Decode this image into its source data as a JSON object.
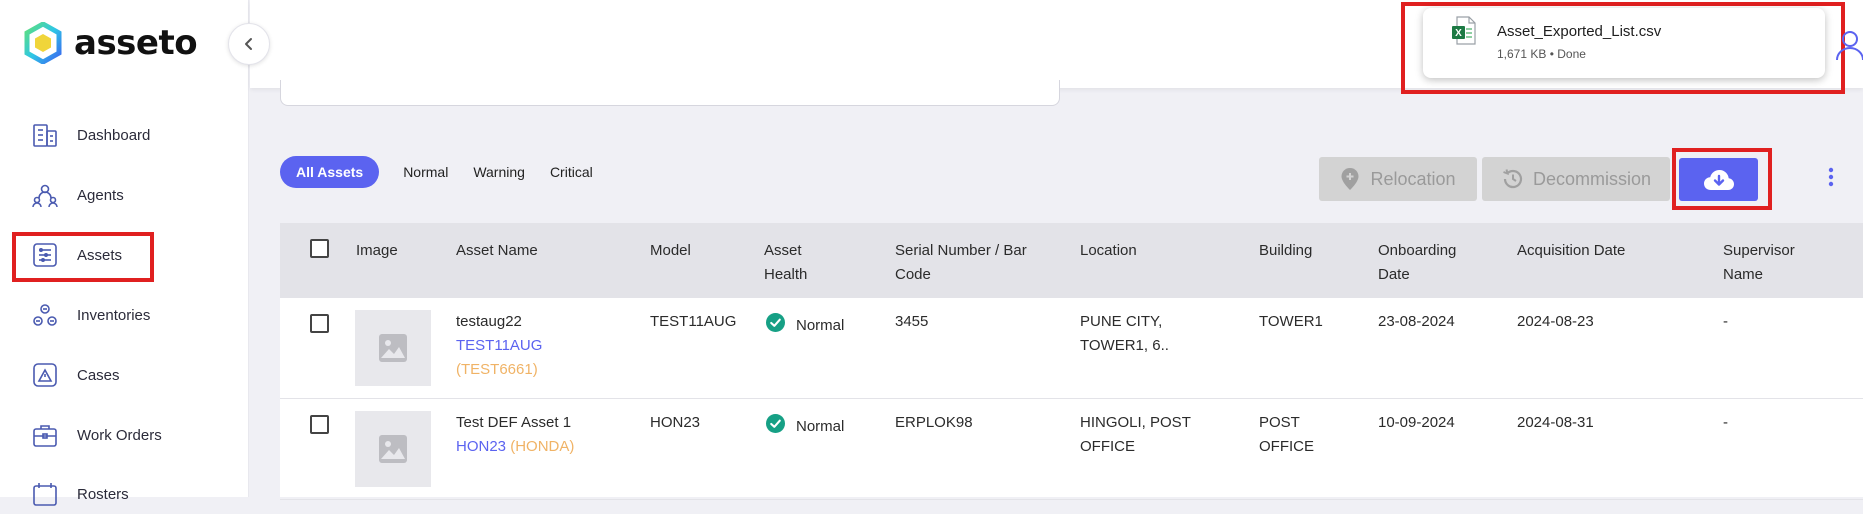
{
  "brand": {
    "name": "asseto"
  },
  "sidebar": {
    "items": [
      {
        "label": "Dashboard",
        "icon": "dashboard-icon"
      },
      {
        "label": "Agents",
        "icon": "agents-icon"
      },
      {
        "label": "Assets",
        "icon": "assets-icon",
        "active": true
      },
      {
        "label": "Inventories",
        "icon": "inventories-icon"
      },
      {
        "label": "Cases",
        "icon": "cases-icon"
      },
      {
        "label": "Work Orders",
        "icon": "work-orders-icon"
      },
      {
        "label": "Rosters",
        "icon": "rosters-icon"
      }
    ]
  },
  "download": {
    "filename": "Asset_Exported_List.csv",
    "meta": "1,671 KB • Done"
  },
  "filters": {
    "tabs": [
      "All Assets",
      "Normal",
      "Warning",
      "Critical"
    ],
    "active": "All Assets"
  },
  "actions": {
    "relocation": "Relocation",
    "decommission": "Decommission"
  },
  "table": {
    "headers": [
      "Image",
      "Asset Name",
      "Model",
      "Asset\nHealth",
      "Serial Number / Bar\nCode",
      "Location",
      "Building",
      "Onboarding\nDate",
      "Acquisition Date",
      "Supervisor\nName"
    ],
    "rows": [
      {
        "asset_name": "testaug22",
        "model_link": "TEST11AUG",
        "brand": "(TEST6661)",
        "model": "TEST11AUG",
        "health": "Normal",
        "serial": "3455",
        "location": "PUNE CITY, TOWER1, 6..",
        "building": "TOWER1",
        "onboarding": "23-08-2024",
        "acquisition": "2024-08-23",
        "supervisor": "-"
      },
      {
        "asset_name": "Test DEF Asset 1",
        "model_link": "HON23",
        "brand": "(HONDA)",
        "model": "HON23",
        "health": "Normal",
        "serial": "ERPLOK98",
        "location": "HINGOLI, POST OFFICE",
        "building": "POST OFFICE",
        "onboarding": "10-09-2024",
        "acquisition": "2024-08-31",
        "supervisor": "-"
      }
    ]
  },
  "colors": {
    "accent": "#5b63f0",
    "highlight": "#e02020",
    "success": "#16a085",
    "brand_orange": "#f0b366"
  }
}
